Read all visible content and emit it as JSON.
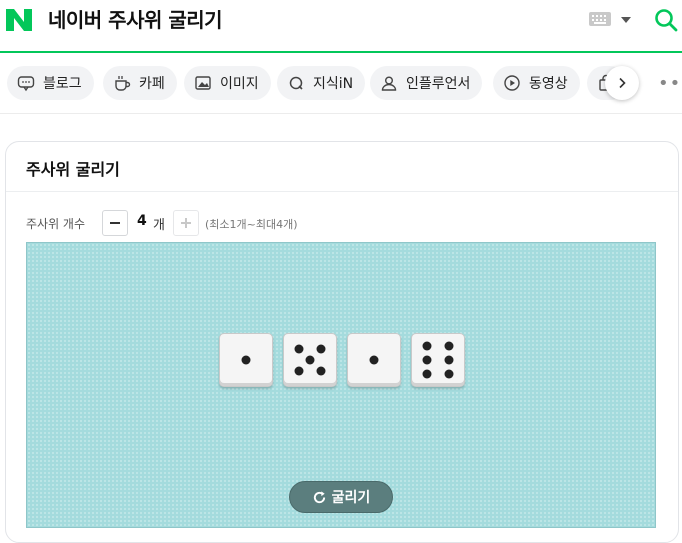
{
  "header": {
    "title": "네이버 주사위 굴리기",
    "logo_letter": "N",
    "brand_color": "#03c75a"
  },
  "tabs": [
    {
      "label": "블로그",
      "icon": "blog-icon"
    },
    {
      "label": "카페",
      "icon": "cafe-icon"
    },
    {
      "label": "이미지",
      "icon": "image-icon"
    },
    {
      "label": "지식iN",
      "icon": "kin-icon"
    },
    {
      "label": "인플루언서",
      "icon": "influencer-icon"
    },
    {
      "label": "동영상",
      "icon": "video-icon"
    }
  ],
  "widget": {
    "title": "주사위 굴리기",
    "count_label": "주사위 개수",
    "count_value": "4",
    "count_unit": "개",
    "count_range": "(최소1개~최대4개)",
    "dice_values": [
      1,
      5,
      1,
      6
    ],
    "roll_label": "굴리기",
    "board_color": "#a4dbdd"
  }
}
